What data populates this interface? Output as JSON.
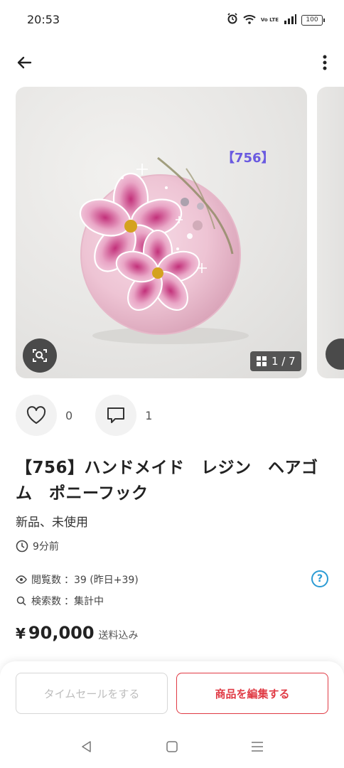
{
  "status_bar": {
    "time": "20:53",
    "volte": "Vo LTE",
    "battery": "100"
  },
  "nav": {
    "back_icon": "arrow-left-icon",
    "menu_icon": "more-vertical-icon"
  },
  "gallery": {
    "item_tag": "【756】",
    "counter": "1 / 7",
    "counter_icon": "grid-icon",
    "zoom_icon": "image-search-icon"
  },
  "actions": {
    "like_count": "0",
    "comment_count": "1"
  },
  "product": {
    "title": "【756】ハンドメイド　レジン　ヘアゴム　ポニーフック",
    "condition": "新品、未使用",
    "posted": "9分前"
  },
  "stats": {
    "views_label": "閲覧数",
    "views_value": "：39 (昨日+39)",
    "search_label": "検索数",
    "search_value": "：集計中",
    "help": "?"
  },
  "price": {
    "symbol": "¥",
    "value": "90,000",
    "note": "送料込み"
  },
  "buttons": {
    "timesale": "タイムセールをする",
    "edit": "商品を編集する"
  },
  "colors": {
    "accent_red": "#e03a44",
    "help_blue": "#2b9bd4",
    "tag_purple": "#6a5ae0"
  }
}
